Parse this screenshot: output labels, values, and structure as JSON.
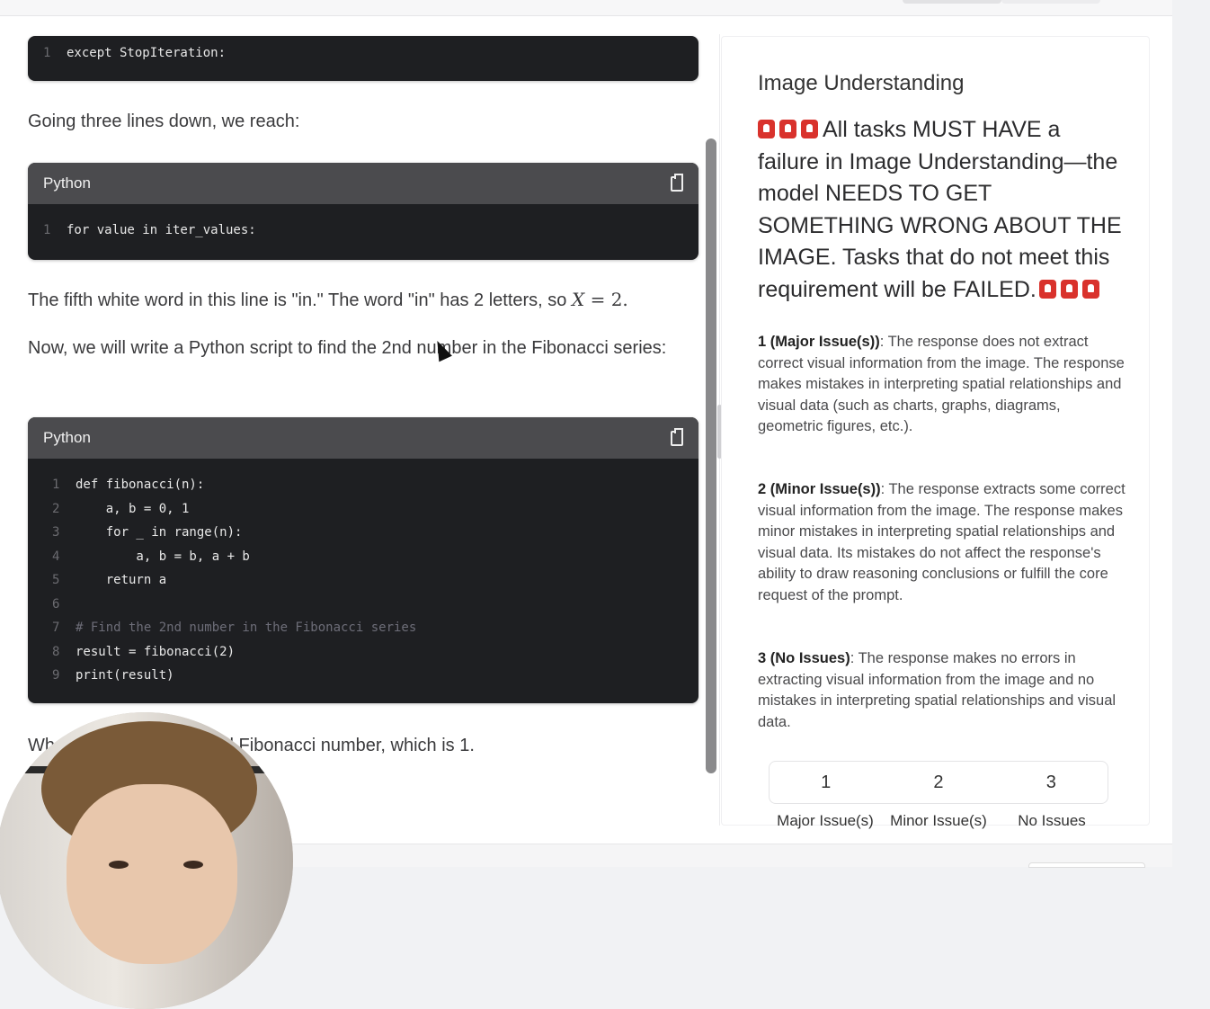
{
  "left": {
    "code_block_top": {
      "lines": [
        {
          "num": "1",
          "text": "except StopIteration:"
        }
      ]
    },
    "para1": "Going three lines down, we reach:",
    "code_block_1": {
      "language": "Python",
      "lines": [
        {
          "num": "1",
          "text": "for value in iter_values:"
        }
      ]
    },
    "para2_text": "The fifth white word in this line is \"in.\" The word \"in\" has 2 letters, so ",
    "para2_math_var": "X",
    "para2_math_rest": " = 2.",
    "para3": "Now, we will write a Python script to find the 2nd number in the Fibonacci series:",
    "code_block_2": {
      "language": "Python",
      "lines": [
        {
          "num": "1",
          "text": "def fibonacci(n):"
        },
        {
          "num": "2",
          "text": "    a, b = 0, 1"
        },
        {
          "num": "3",
          "text": "    for _ in range(n):"
        },
        {
          "num": "4",
          "text": "        a, b = b, a + b"
        },
        {
          "num": "5",
          "text": "    return a"
        },
        {
          "num": "6",
          "text": ""
        },
        {
          "num": "7",
          "text": "# Find the 2nd number in the Fibonacci series"
        },
        {
          "num": "8",
          "text": "result = fibonacci(2)"
        },
        {
          "num": "9",
          "text": "print(result)"
        }
      ]
    },
    "para4": "Wh                          t, it will output the 2nd Fibonacci number, which is 1."
  },
  "right": {
    "title": "Image Understanding",
    "warning": "All tasks MUST HAVE a failure in Image Understanding—the model NEEDS TO GET SOMETHING WRONG ABOUT THE IMAGE. Tasks that do not meet this requirement will be FAILED.",
    "criteria": [
      {
        "label": "1 (Major Issue(s))",
        "text": ": The response does not extract correct visual information from the image. The response makes mistakes in interpreting spatial relationships and visual data (such as charts, graphs, diagrams, geometric figures, etc.)."
      },
      {
        "label": "2 (Minor Issue(s))",
        "text": ": The response extracts some correct visual information from the image. The response makes minor mistakes in interpreting spatial relationships and visual data. Its mistakes do not affect the response's ability to draw reasoning conclusions or fulfill the core request of the prompt."
      },
      {
        "label": "3 (No Issues)",
        "text": ": The response makes no errors in extracting visual information from the image and no mistakes in interpreting spatial relationships and visual data."
      }
    ],
    "rating_options": [
      "1",
      "2",
      "3"
    ],
    "rating_labels": [
      "Major Issue(s)",
      "Minor Issue(s)",
      "No Issues"
    ]
  },
  "icons": {
    "copy": "copy-icon",
    "warning": "police-light-icon",
    "cursor": "mouse-pointer-icon"
  }
}
